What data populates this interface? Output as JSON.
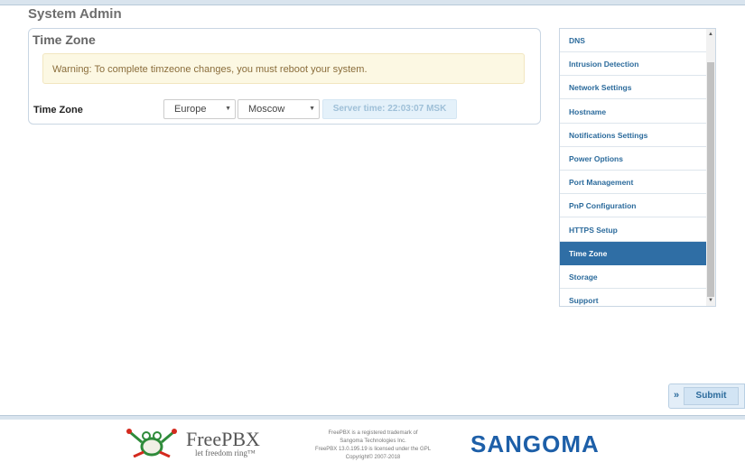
{
  "header": {
    "page_title": "System Admin"
  },
  "panel": {
    "title": "Time Zone",
    "warning": "Warning: To complete timzeone changes, you must reboot your system.",
    "field_label": "Time Zone",
    "region_value": "Europe",
    "city_value": "Moscow",
    "server_time": "Server time: 22:03:07 MSK"
  },
  "sidebar": {
    "items": [
      {
        "label": "DNS"
      },
      {
        "label": "Intrusion Detection"
      },
      {
        "label": "Network Settings"
      },
      {
        "label": "Hostname"
      },
      {
        "label": "Notifications Settings"
      },
      {
        "label": "Power Options"
      },
      {
        "label": "Port Management"
      },
      {
        "label": "PnP Configuration"
      },
      {
        "label": "HTTPS Setup"
      },
      {
        "label": "Time Zone"
      },
      {
        "label": "Storage"
      },
      {
        "label": "Support"
      }
    ],
    "active_index": 9
  },
  "actions": {
    "submit_label": "Submit",
    "submit_chevron": "»"
  },
  "footer": {
    "freepbx_name": "FreePBX",
    "freepbx_tagline": "let freedom ring™",
    "legal_line1": "FreePBX is a registered trademark of",
    "legal_line2": "Sangoma Technologies Inc.",
    "legal_line3": "FreePBX 13.0.195.19 is licensed under the GPL",
    "legal_line4": "Copyright© 2007-2018",
    "sangoma_logo": "SANGOMA"
  },
  "colors": {
    "accent": "#2f6ea5",
    "link": "#2c6b9c",
    "warning_bg": "#fcf8e3",
    "warning_text": "#8a6d3b"
  }
}
